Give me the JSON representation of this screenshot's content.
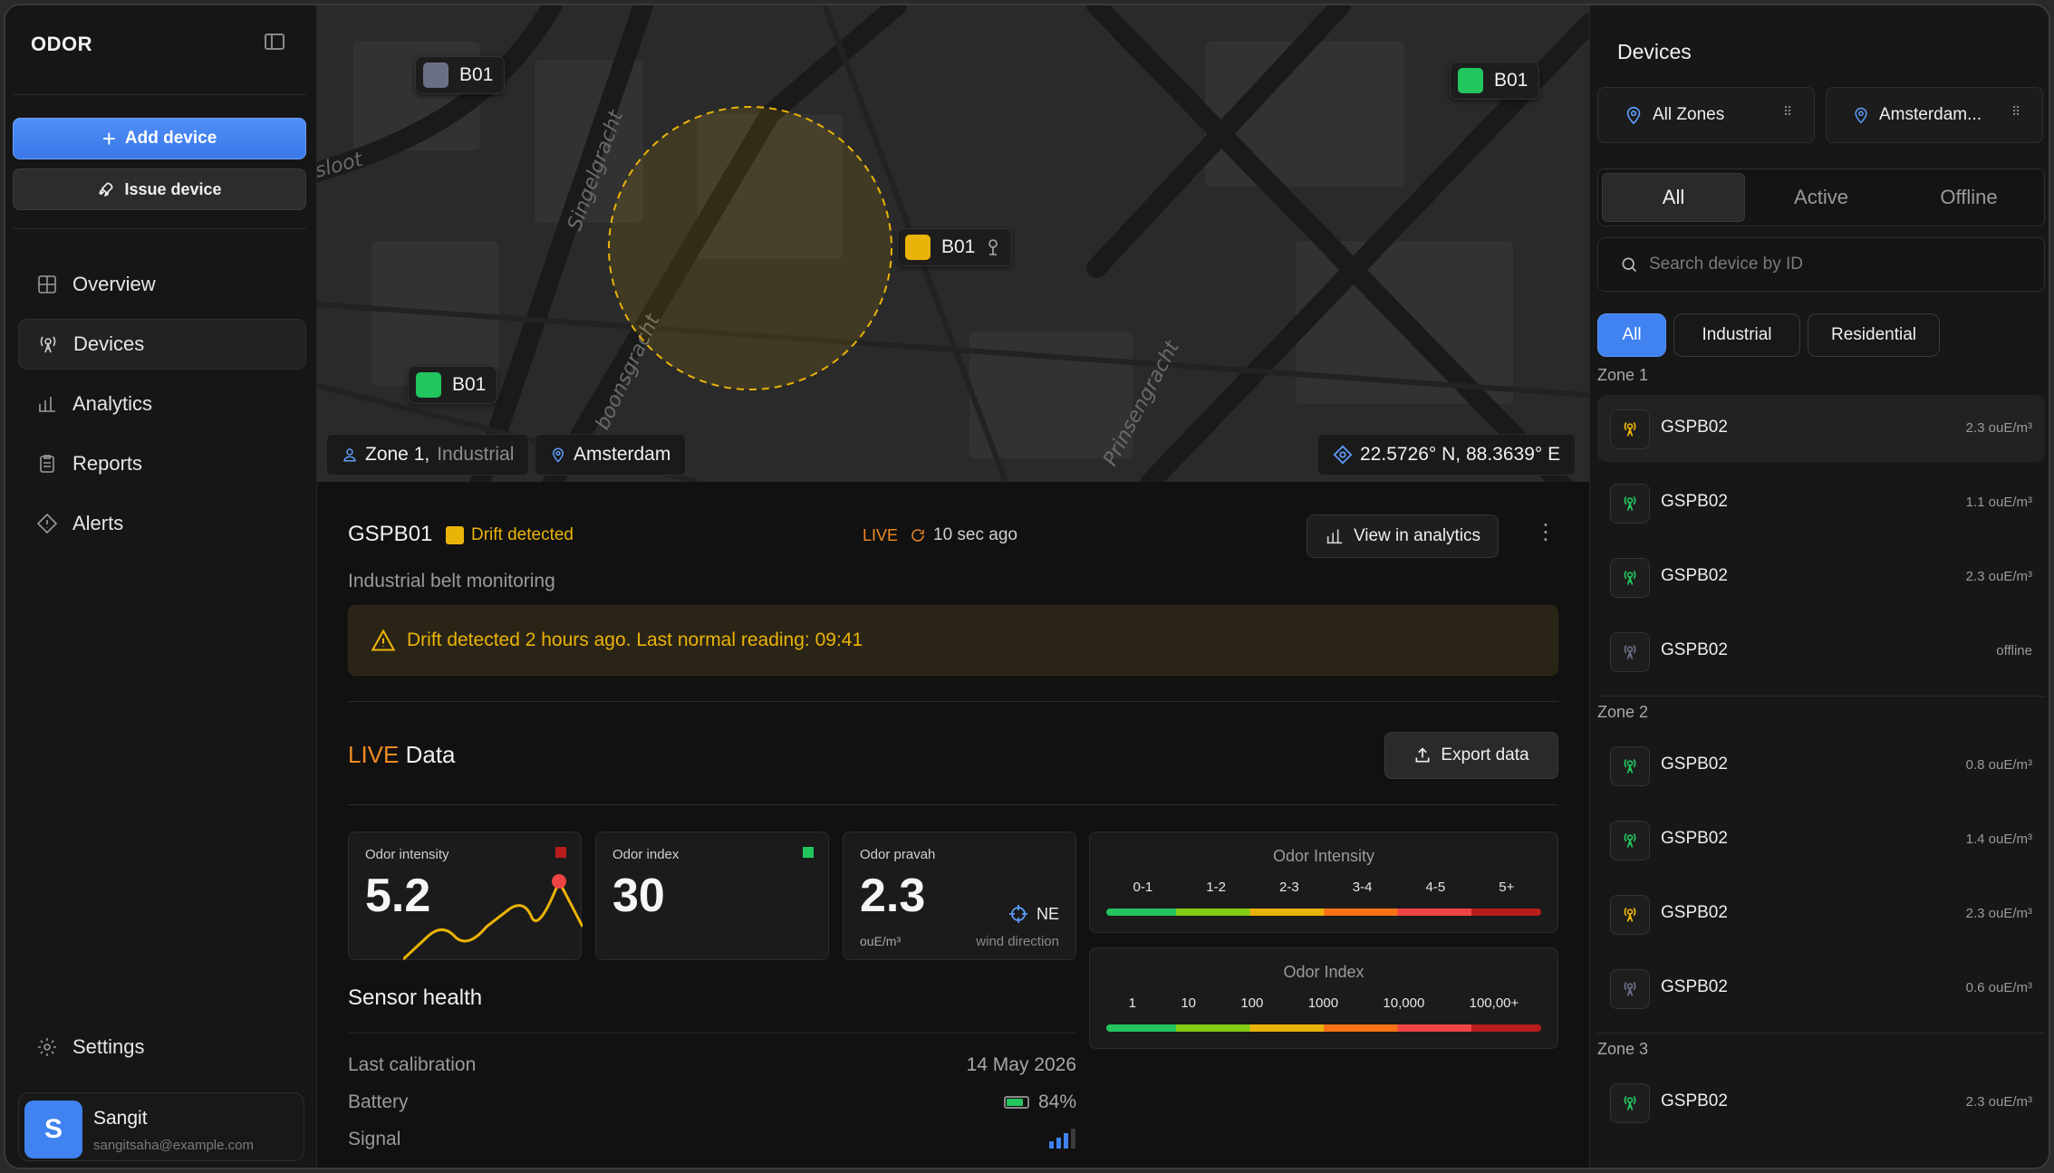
{
  "sidebar": {
    "brand": "ODOR",
    "add_device": "Add device",
    "issue_device": "Issue device",
    "nav": [
      {
        "label": "Overview",
        "icon": "grid-icon"
      },
      {
        "label": "Devices",
        "icon": "tower-icon"
      },
      {
        "label": "Analytics",
        "icon": "bar-chart-icon"
      },
      {
        "label": "Reports",
        "icon": "clipboard-icon"
      },
      {
        "label": "Alerts",
        "icon": "warning-diamond-icon"
      }
    ],
    "settings": "Settings",
    "user": {
      "initial": "S",
      "name": "Sangit",
      "email": "sangitsaha@example.com"
    }
  },
  "map": {
    "pins": [
      {
        "label": "B01",
        "status": "offline",
        "color": "#6b6f86"
      },
      {
        "label": "B01",
        "status": "active",
        "color": "#22c55e"
      },
      {
        "label": "B01",
        "status": "drift",
        "color": "#eab308"
      },
      {
        "label": "B01",
        "status": "active",
        "color": "#22c55e"
      }
    ],
    "zone": "Zone 1,",
    "zone_type": "Industrial",
    "city": "Amsterdam",
    "coordinates": "22.5726° N, 88.3639° E",
    "streets": [
      "sloot",
      "Singelgracht",
      "boonsgracht",
      "Prinsengracht"
    ]
  },
  "device": {
    "id": "GSPB01",
    "status": "Drift detected",
    "live": "LIVE",
    "updated": "10 sec ago",
    "view_analytics": "View in analytics",
    "description": "Industrial belt monitoring",
    "alert": "Drift detected 2 hours ago. Last normal reading: 09:41"
  },
  "live_data": {
    "title_live": "LIVE",
    "title_rest": " Data",
    "export": "Export data",
    "metrics": [
      {
        "label": "Odor intensity",
        "value": "5.2",
        "indicator": "#b91c1c"
      },
      {
        "label": "Odor index",
        "value": "30",
        "indicator": "#22c55e"
      },
      {
        "label": "Odor pravah",
        "value": "2.3",
        "unit": "ouE/m³",
        "wind": "NE",
        "wind_label": "wind direction"
      }
    ],
    "intensity_scale": {
      "title": "Odor Intensity",
      "ticks": [
        "0-1",
        "1-2",
        "2-3",
        "3-4",
        "4-5",
        "5+"
      ]
    },
    "index_scale": {
      "title": "Odor Index",
      "ticks": [
        "1",
        "10",
        "100",
        "1000",
        "10,000",
        "100,00+"
      ]
    }
  },
  "sensor_health": {
    "title": "Sensor health",
    "rows": [
      {
        "label": "Last calibration",
        "value": "14 May 2026"
      },
      {
        "label": "Battery",
        "value": "84%",
        "battery_level": 0.84
      },
      {
        "label": "Signal",
        "value": "",
        "bars": 3
      }
    ]
  },
  "devices_panel": {
    "title": "Devices",
    "zone_select": "All Zones",
    "city_select": "Amsterdam...",
    "tabs": [
      "All",
      "Active",
      "Offline"
    ],
    "search_placeholder": "Search device  by ID",
    "filters": [
      "All",
      "Industrial",
      "Residential"
    ],
    "zones": [
      {
        "name": "Zone 1",
        "devices": [
          {
            "id": "GSPB02",
            "reading": "2.3 ouE/m³",
            "status": "drift"
          },
          {
            "id": "GSPB02",
            "reading": "1.1 ouE/m³",
            "status": "active"
          },
          {
            "id": "GSPB02",
            "reading": "2.3 ouE/m³",
            "status": "active"
          },
          {
            "id": "GSPB02",
            "reading": "offline",
            "status": "offline"
          }
        ]
      },
      {
        "name": "Zone 2",
        "devices": [
          {
            "id": "GSPB02",
            "reading": "0.8 ouE/m³",
            "status": "active"
          },
          {
            "id": "GSPB02",
            "reading": "1.4 ouE/m³",
            "status": "active"
          },
          {
            "id": "GSPB02",
            "reading": "2.3 ouE/m³",
            "status": "drift"
          },
          {
            "id": "GSPB02",
            "reading": "0.6 ouE/m³",
            "status": "offline"
          }
        ]
      },
      {
        "name": "Zone 3",
        "devices": [
          {
            "id": "GSPB02",
            "reading": "2.3 ouE/m³",
            "status": "active"
          }
        ]
      }
    ]
  },
  "colors": {
    "accent": "#3f82f0",
    "active": "#22c55e",
    "drift": "#eab308",
    "offline": "#6b6f86",
    "live": "#f08a24"
  }
}
